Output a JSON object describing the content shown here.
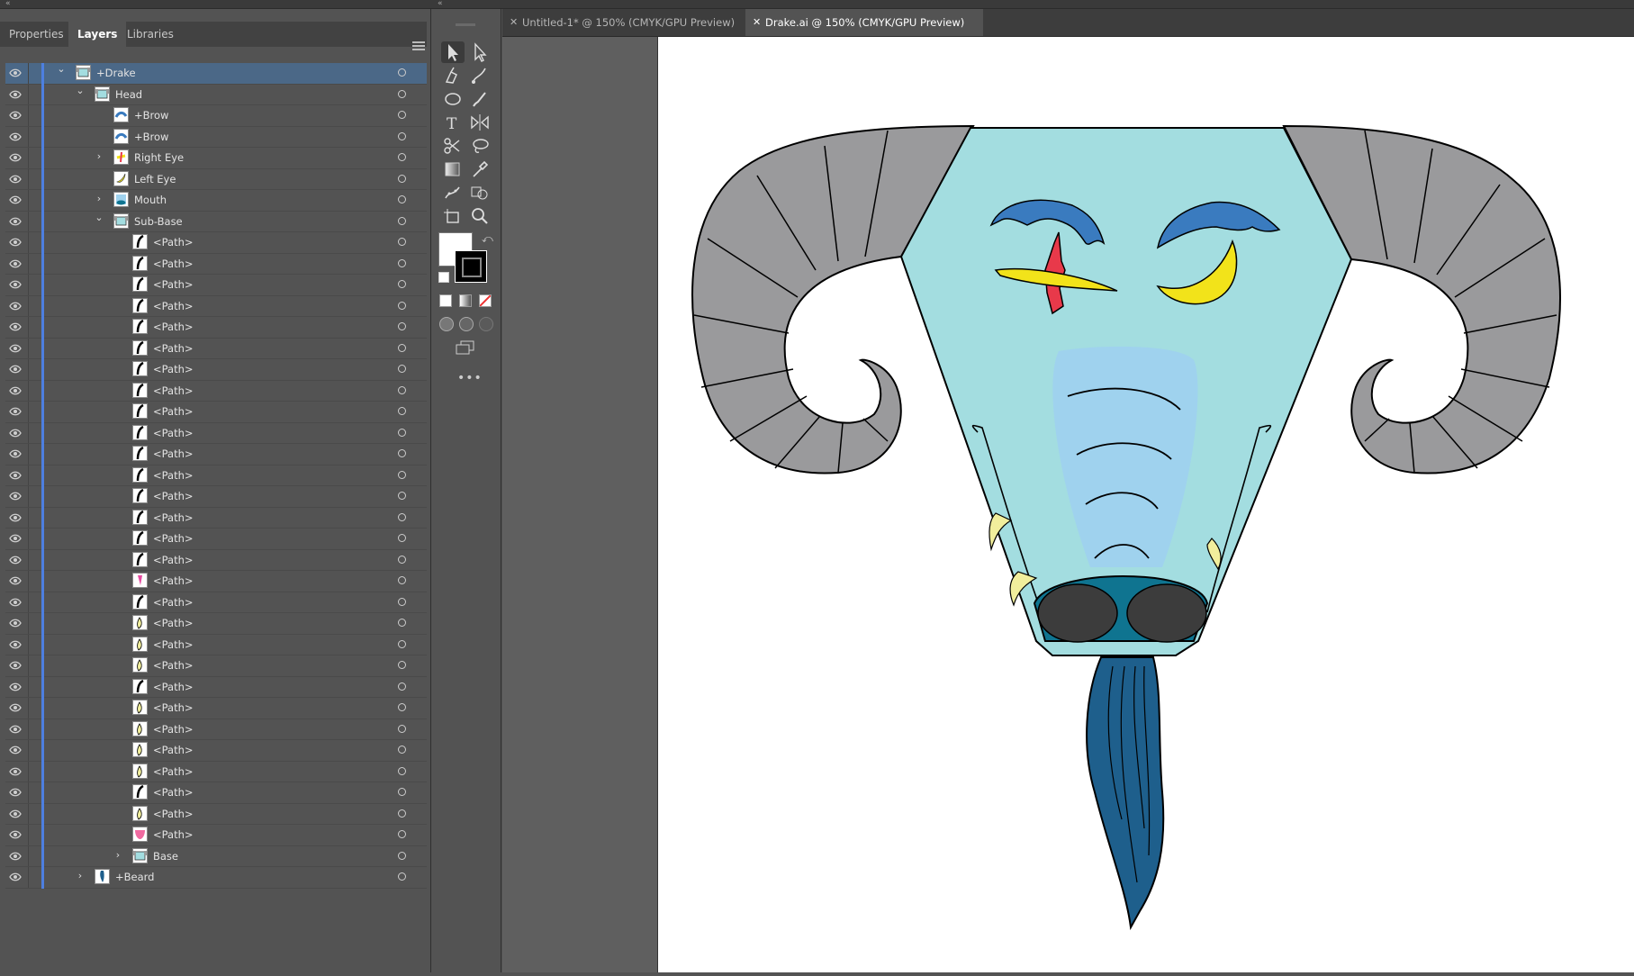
{
  "panel": {
    "tabs": [
      "Properties",
      "Layers",
      "Libraries"
    ],
    "active_tab": "Layers"
  },
  "layers": [
    {
      "label": "+Drake",
      "indent": 0,
      "chevron": "down",
      "thumb": "face",
      "selected": true
    },
    {
      "label": "Head",
      "indent": 1,
      "chevron": "down",
      "thumb": "face"
    },
    {
      "label": "+Brow",
      "indent": 2,
      "chevron": "",
      "thumb": "brow"
    },
    {
      "label": "+Brow",
      "indent": 2,
      "chevron": "",
      "thumb": "brow"
    },
    {
      "label": "Right Eye",
      "indent": 2,
      "chevron": "right",
      "thumb": "eye-red"
    },
    {
      "label": "Left Eye",
      "indent": 2,
      "chevron": "",
      "thumb": "eye-yellow"
    },
    {
      "label": "Mouth",
      "indent": 2,
      "chevron": "right",
      "thumb": "mouth"
    },
    {
      "label": "Sub-Base",
      "indent": 2,
      "chevron": "down",
      "thumb": "face"
    },
    {
      "label": "<Path>",
      "indent": 3,
      "chevron": "",
      "thumb": "path"
    },
    {
      "label": "<Path>",
      "indent": 3,
      "chevron": "",
      "thumb": "path"
    },
    {
      "label": "<Path>",
      "indent": 3,
      "chevron": "",
      "thumb": "path"
    },
    {
      "label": "<Path>",
      "indent": 3,
      "chevron": "",
      "thumb": "path"
    },
    {
      "label": "<Path>",
      "indent": 3,
      "chevron": "",
      "thumb": "path"
    },
    {
      "label": "<Path>",
      "indent": 3,
      "chevron": "",
      "thumb": "path"
    },
    {
      "label": "<Path>",
      "indent": 3,
      "chevron": "",
      "thumb": "path"
    },
    {
      "label": "<Path>",
      "indent": 3,
      "chevron": "",
      "thumb": "path"
    },
    {
      "label": "<Path>",
      "indent": 3,
      "chevron": "",
      "thumb": "path"
    },
    {
      "label": "<Path>",
      "indent": 3,
      "chevron": "",
      "thumb": "path"
    },
    {
      "label": "<Path>",
      "indent": 3,
      "chevron": "",
      "thumb": "path"
    },
    {
      "label": "<Path>",
      "indent": 3,
      "chevron": "",
      "thumb": "path"
    },
    {
      "label": "<Path>",
      "indent": 3,
      "chevron": "",
      "thumb": "path"
    },
    {
      "label": "<Path>",
      "indent": 3,
      "chevron": "",
      "thumb": "path"
    },
    {
      "label": "<Path>",
      "indent": 3,
      "chevron": "",
      "thumb": "path"
    },
    {
      "label": "<Path>",
      "indent": 3,
      "chevron": "",
      "thumb": "path"
    },
    {
      "label": "<Path>",
      "indent": 3,
      "chevron": "",
      "thumb": "path-pink"
    },
    {
      "label": "<Path>",
      "indent": 3,
      "chevron": "",
      "thumb": "path"
    },
    {
      "label": "<Path>",
      "indent": 3,
      "chevron": "",
      "thumb": "path-yellow"
    },
    {
      "label": "<Path>",
      "indent": 3,
      "chevron": "",
      "thumb": "path-yellow"
    },
    {
      "label": "<Path>",
      "indent": 3,
      "chevron": "",
      "thumb": "path-yellow"
    },
    {
      "label": "<Path>",
      "indent": 3,
      "chevron": "",
      "thumb": "path"
    },
    {
      "label": "<Path>",
      "indent": 3,
      "chevron": "",
      "thumb": "path-yellow"
    },
    {
      "label": "<Path>",
      "indent": 3,
      "chevron": "",
      "thumb": "path-yellow"
    },
    {
      "label": "<Path>",
      "indent": 3,
      "chevron": "",
      "thumb": "path-yellow"
    },
    {
      "label": "<Path>",
      "indent": 3,
      "chevron": "",
      "thumb": "path-yellow"
    },
    {
      "label": "<Path>",
      "indent": 3,
      "chevron": "",
      "thumb": "path"
    },
    {
      "label": "<Path>",
      "indent": 3,
      "chevron": "",
      "thumb": "path-yellow"
    },
    {
      "label": "<Path>",
      "indent": 3,
      "chevron": "",
      "thumb": "path-pinkfill"
    },
    {
      "label": "Base",
      "indent": 3,
      "chevron": "right",
      "thumb": "face"
    },
    {
      "label": "+Beard",
      "indent": 1,
      "chevron": "right",
      "thumb": "beard"
    }
  ],
  "documents": [
    {
      "title": "Untitled-1* @ 150% (CMYK/GPU Preview)",
      "active": false
    },
    {
      "title": "Drake.ai @ 150% (CMYK/GPU Preview)",
      "active": true
    }
  ],
  "tools": [
    "selection-tool",
    "direct-selection-tool",
    "pen-tool",
    "curvature-tool",
    "ellipse-tool",
    "paintbrush-tool",
    "type-tool",
    "reflect-tool",
    "scissors-tool",
    "lasso-tool",
    "gradient-tool",
    "eyedropper-tool",
    "puppet-warp-tool",
    "shape-builder-tool",
    "artboard-tool",
    "zoom-tool"
  ],
  "more_tools_label": "•••",
  "colors": {
    "face": "#a3dde0",
    "horn": "#9a9a9c",
    "brow": "#3a7bbf",
    "eye_yellow": "#f2e31a",
    "eye_red": "#e8394a",
    "muzzle": "#9fd2ee",
    "nose": "#0f7490",
    "nostril": "#3c3c3c",
    "beard": "#1e5f8c",
    "tusk": "#f1ee9c",
    "layer_color": "#4d7fe0"
  }
}
